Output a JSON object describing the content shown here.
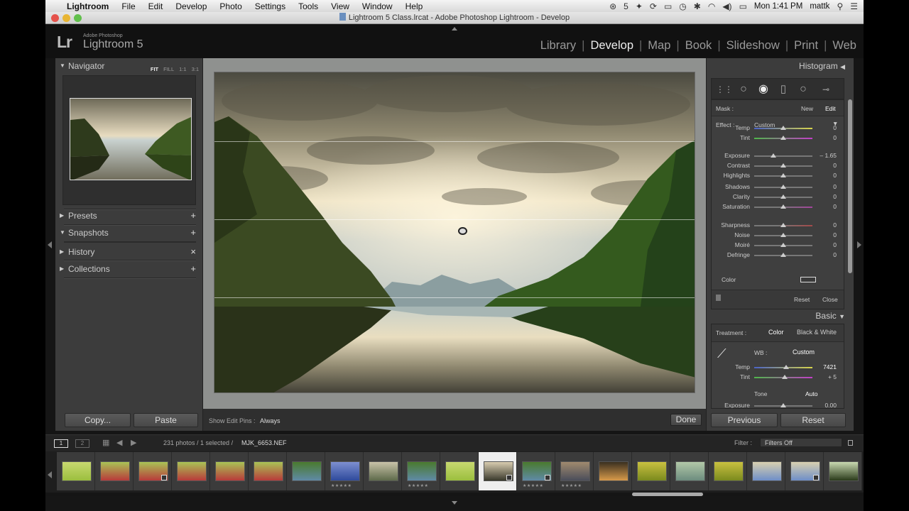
{
  "menubar": {
    "app": "Lightroom",
    "items": [
      "File",
      "Edit",
      "Develop",
      "Photo",
      "Settings",
      "Tools",
      "View",
      "Window",
      "Help"
    ],
    "status_badge": "5",
    "clock": "Mon 1:41 PM",
    "user": "mattk"
  },
  "window": {
    "title": "Lightroom 5 Class.lrcat - Adobe Photoshop Lightroom - Develop"
  },
  "identity": {
    "logo": "Lr",
    "vendor": "Adobe Photoshop",
    "product": "Lightroom 5"
  },
  "modules": [
    {
      "label": "Library",
      "active": false
    },
    {
      "label": "Develop",
      "active": true
    },
    {
      "label": "Map",
      "active": false
    },
    {
      "label": "Book",
      "active": false
    },
    {
      "label": "Slideshow",
      "active": false
    },
    {
      "label": "Print",
      "active": false
    },
    {
      "label": "Web",
      "active": false
    }
  ],
  "left_panel": {
    "navigator": {
      "title": "Navigator",
      "zoom": [
        "FIT",
        "FILL",
        "1:1",
        "3:1"
      ]
    },
    "presets": {
      "title": "Presets",
      "action": "+"
    },
    "snapshots": {
      "title": "Snapshots",
      "action": "+"
    },
    "history": {
      "title": "History",
      "action": "×"
    },
    "collections": {
      "title": "Collections",
      "action": "+"
    },
    "copy_label": "Copy...",
    "paste_label": "Paste"
  },
  "toolbar": {
    "pins_label": "Show Edit Pins :",
    "pins_value": "Always",
    "done_label": "Done"
  },
  "right_panel": {
    "histogram_title": "Histogram",
    "mask_label": "Mask :",
    "mask_new": "New",
    "mask_edit": "Edit",
    "effect_label": "Effect :",
    "effect_value": "Custom",
    "sliders": [
      {
        "label": "Temp",
        "value": "0",
        "pos": 0.5,
        "color": "temp"
      },
      {
        "label": "Tint",
        "value": "0",
        "pos": 0.5,
        "color": "tint"
      },
      {
        "label": "Exposure",
        "value": "– 1.65",
        "pos": 0.33,
        "color": "plain"
      },
      {
        "label": "Contrast",
        "value": "0",
        "pos": 0.5,
        "color": "plain"
      },
      {
        "label": "Highlights",
        "value": "0",
        "pos": 0.5,
        "color": "plain"
      },
      {
        "label": "Shadows",
        "value": "0",
        "pos": 0.5,
        "color": "plain"
      },
      {
        "label": "Clarity",
        "value": "0",
        "pos": 0.5,
        "color": "plain"
      },
      {
        "label": "Saturation",
        "value": "0",
        "pos": 0.5,
        "color": "sat"
      },
      {
        "label": "Sharpness",
        "value": "0",
        "pos": 0.5,
        "color": "sharp"
      },
      {
        "label": "Noise",
        "value": "0",
        "pos": 0.5,
        "color": "plain"
      },
      {
        "label": "Moiré",
        "value": "0",
        "pos": 0.5,
        "color": "plain"
      },
      {
        "label": "Defringe",
        "value": "0",
        "pos": 0.5,
        "color": "plain"
      }
    ],
    "color_label": "Color",
    "reset_label": "Reset",
    "close_label": "Close",
    "basic_title": "Basic",
    "treatment_label": "Treatment :",
    "treatment_color": "Color",
    "treatment_bw": "Black & White",
    "wb_label": "WB :",
    "wb_value": "Custom",
    "basic_temp": {
      "label": "Temp",
      "value": "7421"
    },
    "basic_tint": {
      "label": "Tint",
      "value": "+ 5"
    },
    "tone_label": "Tone",
    "auto_label": "Auto",
    "basic_exposure": {
      "label": "Exposure",
      "value": "0.00"
    },
    "previous_label": "Previous",
    "reset_button_label": "Reset"
  },
  "filmstrip": {
    "views": [
      "1",
      "2"
    ],
    "info": "231 photos / 1 selected /",
    "filename": "MJK_6653.NEF",
    "filter_label": "Filter :",
    "filter_value": "Filters Off",
    "stars": "★★★★★",
    "thumbs": [
      {
        "kind": "green",
        "stars": false,
        "badge": false
      },
      {
        "kind": "red",
        "stars": false,
        "badge": false
      },
      {
        "kind": "red",
        "stars": false,
        "badge": true
      },
      {
        "kind": "red",
        "stars": false,
        "badge": false
      },
      {
        "kind": "red",
        "stars": false,
        "badge": false
      },
      {
        "kind": "red",
        "stars": false,
        "badge": false
      },
      {
        "kind": "valley",
        "stars": false,
        "badge": false
      },
      {
        "kind": "blue",
        "stars": true,
        "badge": false
      },
      {
        "kind": "building",
        "stars": false,
        "badge": false
      },
      {
        "kind": "valley",
        "stars": true,
        "badge": false
      },
      {
        "kind": "green",
        "stars": false,
        "badge": false
      },
      {
        "kind": "fjord",
        "stars": false,
        "badge": true,
        "selected": true
      },
      {
        "kind": "valley",
        "stars": true,
        "badge": true
      },
      {
        "kind": "dusk",
        "stars": true,
        "badge": false
      },
      {
        "kind": "sunset",
        "stars": false,
        "badge": false
      },
      {
        "kind": "yellow",
        "stars": false,
        "badge": false
      },
      {
        "kind": "teal",
        "stars": false,
        "badge": false
      },
      {
        "kind": "yellow",
        "stars": false,
        "badge": false
      },
      {
        "kind": "sky",
        "stars": false,
        "badge": false
      },
      {
        "kind": "sky",
        "stars": false,
        "badge": true
      },
      {
        "kind": "fern",
        "stars": false,
        "badge": false
      }
    ]
  }
}
